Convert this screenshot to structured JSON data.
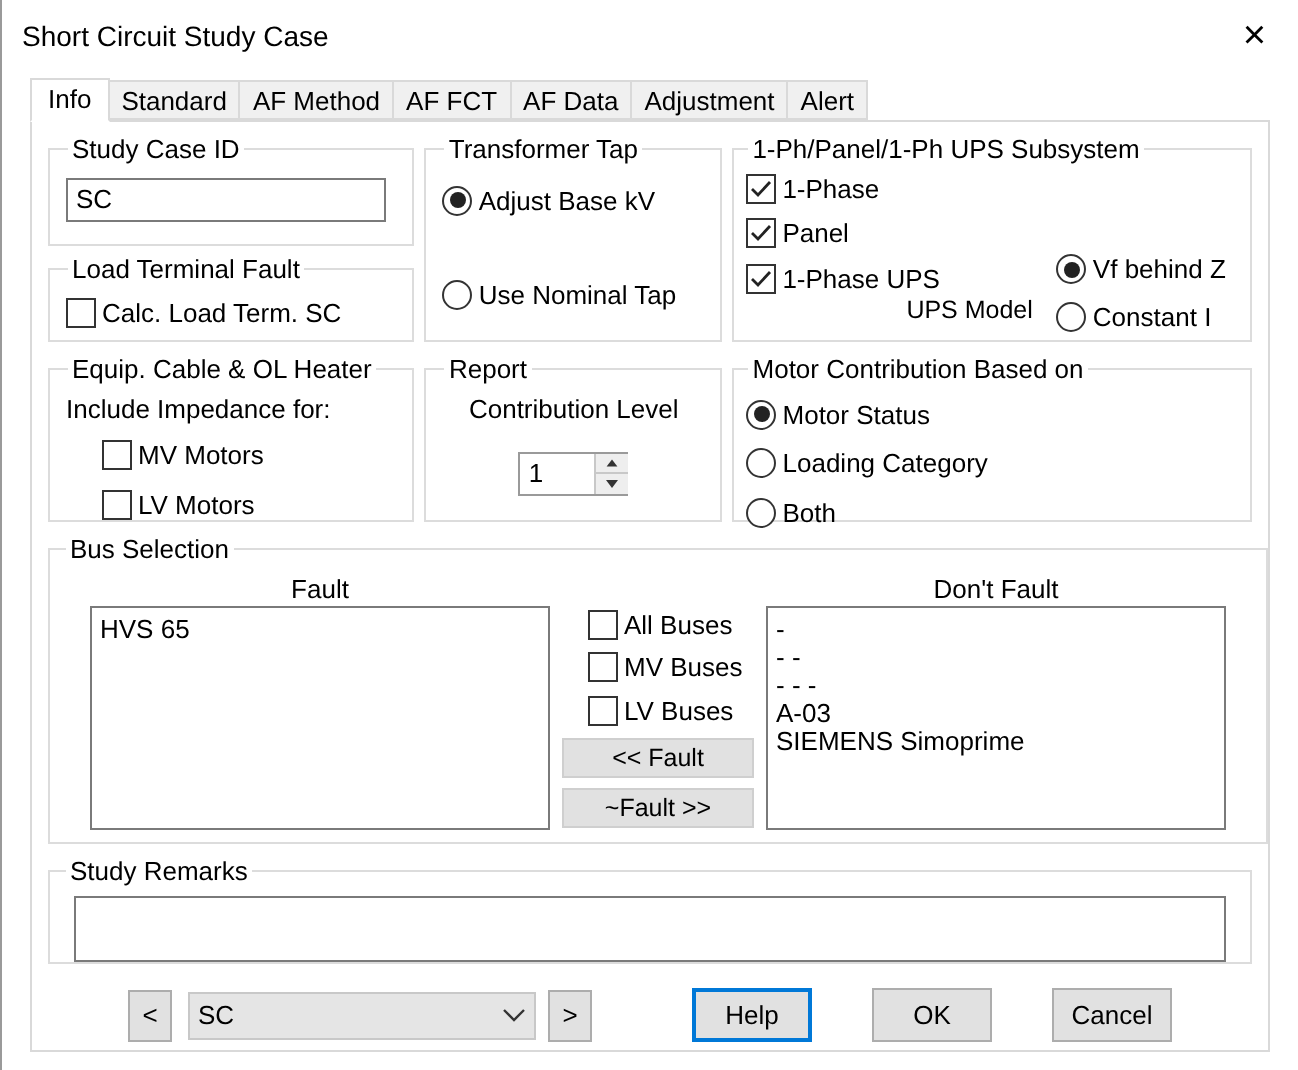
{
  "window": {
    "title": "Short Circuit Study Case",
    "close": "×"
  },
  "tabs": [
    {
      "label": "Info",
      "selected": true
    },
    {
      "label": "Standard",
      "selected": false
    },
    {
      "label": "AF Method",
      "selected": false
    },
    {
      "label": "AF FCT",
      "selected": false
    },
    {
      "label": "AF Data",
      "selected": false
    },
    {
      "label": "Adjustment",
      "selected": false
    },
    {
      "label": "Alert",
      "selected": false
    }
  ],
  "study_case_id": {
    "label": "Study Case ID",
    "value": "SC"
  },
  "load_terminal_fault": {
    "label": "Load Terminal Fault",
    "checkbox": {
      "label": "Calc. Load Term. SC",
      "checked": false
    }
  },
  "transformer_tap": {
    "label": "Transformer Tap",
    "options": [
      {
        "label": "Adjust Base kV",
        "selected": true
      },
      {
        "label": "Use Nominal Tap",
        "selected": false
      }
    ]
  },
  "subsystem": {
    "label": "1-Ph/Panel/1-Ph UPS Subsystem",
    "checks": [
      {
        "label": "1-Phase",
        "checked": true
      },
      {
        "label": "Panel",
        "checked": true
      },
      {
        "label": "1-Phase UPS",
        "checked": true
      }
    ],
    "ups_model": {
      "label": "UPS Model",
      "options": [
        {
          "label": "Vf behind Z",
          "selected": true
        },
        {
          "label": "Constant I",
          "selected": false
        }
      ]
    }
  },
  "equip": {
    "label": "Equip. Cable & OL Heater",
    "caption": "Include Impedance for:",
    "checks": [
      {
        "label": "MV Motors",
        "checked": false
      },
      {
        "label": "LV Motors",
        "checked": false
      }
    ]
  },
  "report": {
    "label": "Report",
    "caption": "Contribution Level",
    "value": "1"
  },
  "motor_contribution": {
    "label": "Motor Contribution Based on",
    "options": [
      {
        "label": "Motor Status",
        "selected": true
      },
      {
        "label": "Loading Category",
        "selected": false
      },
      {
        "label": "Both",
        "selected": false
      }
    ]
  },
  "bus_selection": {
    "label": "Bus Selection",
    "fault": {
      "heading": "Fault",
      "items": [
        "HVS 65"
      ]
    },
    "dont_fault": {
      "heading": "Don't Fault",
      "items": [
        "-",
        "- -",
        "- - -",
        "A-03",
        "SIEMENS Simoprime"
      ]
    },
    "checks": [
      {
        "label": "All Buses",
        "checked": false
      },
      {
        "label": "MV Buses",
        "checked": false
      },
      {
        "label": "LV Buses",
        "checked": false
      }
    ],
    "buttons": [
      "<< Fault",
      "~Fault >>"
    ]
  },
  "study_remarks": {
    "label": "Study Remarks"
  },
  "footer": {
    "prev": "<",
    "combo": "SC",
    "next": ">",
    "buttons": [
      {
        "label": "Help",
        "focused": true
      },
      {
        "label": "OK",
        "focused": false
      },
      {
        "label": "Cancel",
        "focused": false
      }
    ]
  }
}
